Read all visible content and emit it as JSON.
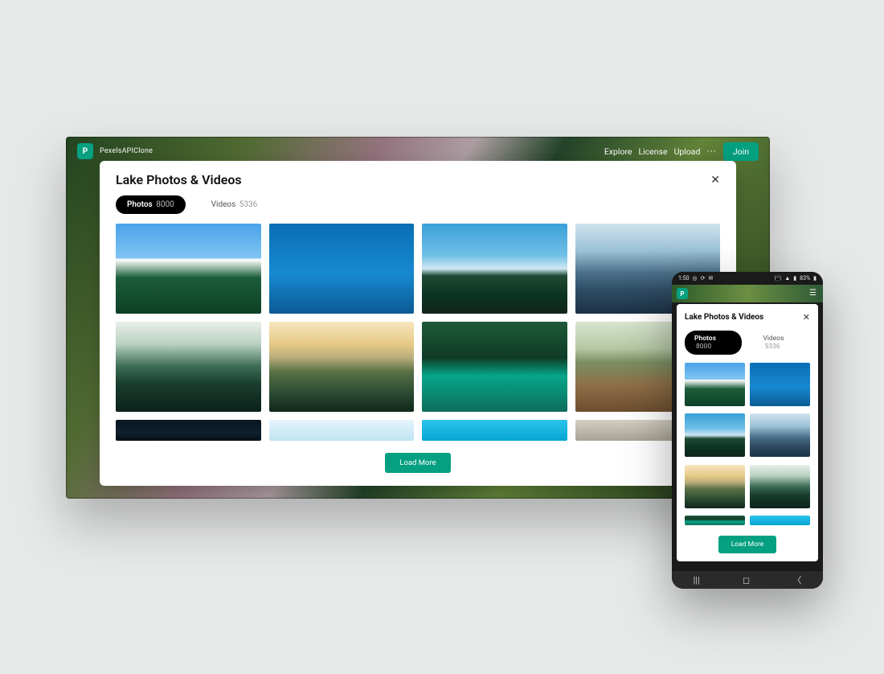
{
  "brand": "PexelsAPIClone",
  "nav": {
    "explore": "Explore",
    "license": "License",
    "upload": "Upload",
    "more": "···",
    "join": "Join"
  },
  "modal": {
    "title": "Lake Photos & Videos",
    "close": "✕",
    "tabs": {
      "photos_label": "Photos",
      "photos_count": "8000",
      "videos_label": "Videos",
      "videos_count": "5336"
    },
    "load_more": "Load More"
  },
  "mobile": {
    "status": {
      "time": "1:50",
      "battery": "83%"
    },
    "menu": "☰"
  },
  "android_nav": {
    "recent": "|||",
    "home": "◻",
    "back": "〈"
  },
  "colors": {
    "accent": "#05a081"
  }
}
